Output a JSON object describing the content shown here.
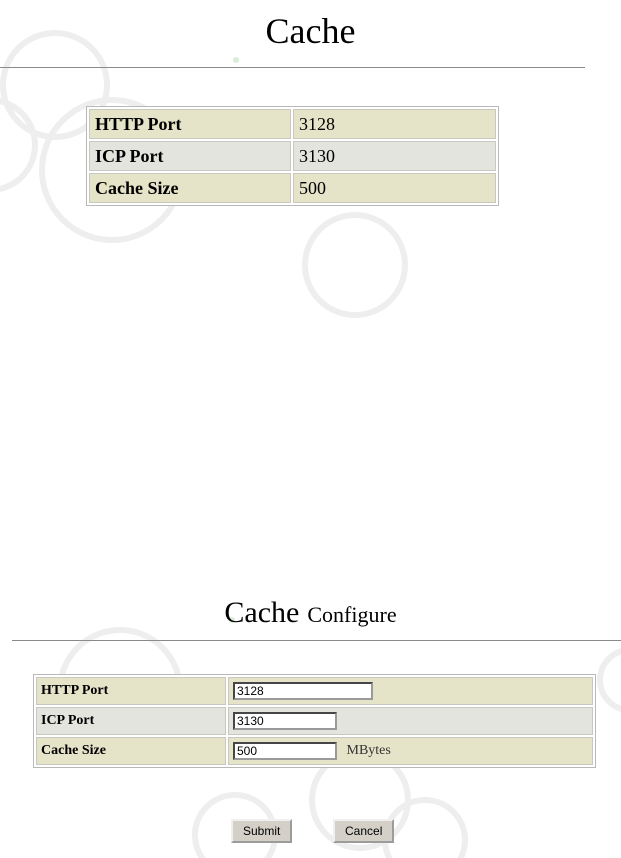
{
  "info_panel": {
    "title": "Cache",
    "rows": [
      {
        "label": "HTTP Port",
        "value": "3128"
      },
      {
        "label": "ICP Port",
        "value": "3130"
      },
      {
        "label": "Cache Size",
        "value": "500"
      }
    ]
  },
  "configure_panel": {
    "title_main": "Cache",
    "title_sub": "Configure",
    "rows": [
      {
        "label": "HTTP Port",
        "value": "3128"
      },
      {
        "label": "ICP Port",
        "value": "3130"
      },
      {
        "label": "Cache Size",
        "value": "500",
        "unit": "MBytes"
      }
    ],
    "submit_label": "Submit",
    "cancel_label": "Cancel"
  }
}
